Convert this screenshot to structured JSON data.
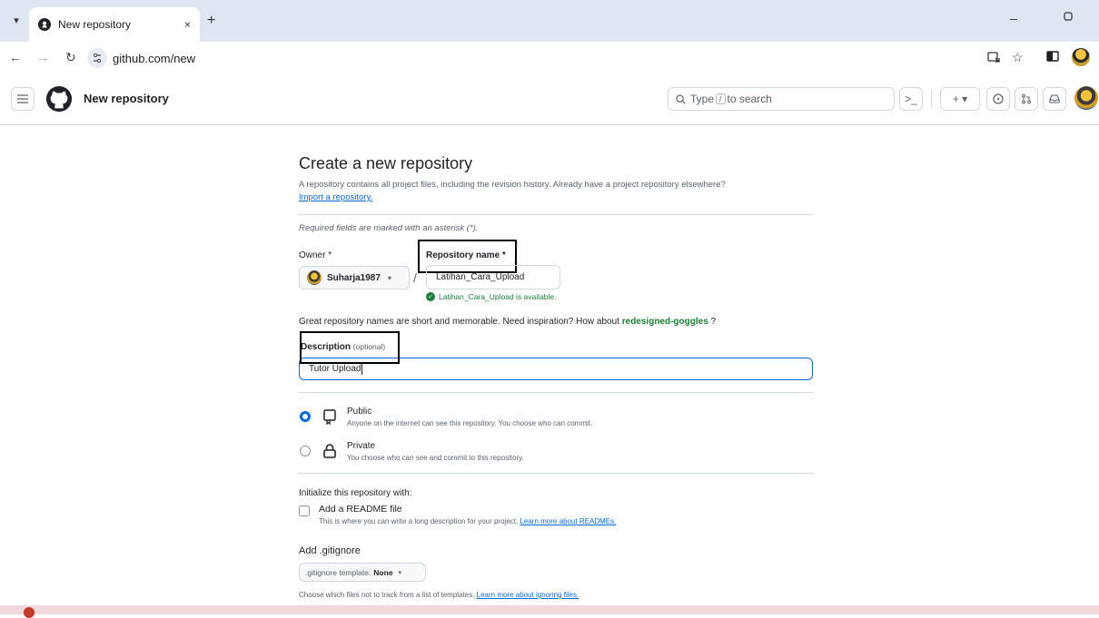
{
  "browser": {
    "tab_title": "New repository",
    "tab_close": "×",
    "new_tab": "+",
    "url": "github.com/new",
    "window_minimize": "–"
  },
  "header": {
    "title": "New repository",
    "search_prefix": "Type",
    "search_key": "/",
    "search_suffix": "to search",
    "terminal_label": ">_",
    "create_label": "+ ▾"
  },
  "page": {
    "heading": "Create a new repository",
    "lead": "A repository contains all project files, including the revision history. Already have a project repository elsewhere?",
    "import_link": "Import a repository.",
    "required_note": "Required fields are marked with an asterisk (*)."
  },
  "form": {
    "owner_label": "Owner *",
    "owner_value": "Suharja1987",
    "repo_name_label": "Repository name *",
    "repo_name_value": "Latihan_Cara_Upload",
    "availability": "Latihan_Cara_Upload is available.",
    "hint_text": "Great repository names are short and memorable. Need inspiration? How about ",
    "hint_suggestion": "redesigned-goggles",
    "hint_end": " ?",
    "description_label": "Description",
    "description_optional": "(optional)",
    "description_value": "Tutor Upload"
  },
  "visibility": {
    "selected": "public",
    "options": [
      {
        "id": "public",
        "title": "Public",
        "desc": "Anyone on the internet can see this repository. You choose who can commit."
      },
      {
        "id": "private",
        "title": "Private",
        "desc": "You choose who can see and commit to this repository."
      }
    ]
  },
  "initialize": {
    "title": "Initialize this repository with:",
    "readme_label": "Add a README file",
    "readme_desc": "This is where you can write a long description for your project.",
    "readme_link": "Learn more about READMEs.",
    "readme_checked": false
  },
  "gitignore": {
    "title": "Add .gitignore",
    "template_prefix": ".gitignore template:",
    "template_value": "None",
    "desc": "Choose which files not to track from a list of templates.",
    "link": "Learn more about ignoring files."
  },
  "colors": {
    "accent": "#0969da",
    "success": "#1a7f37",
    "border": "#d0d7de"
  }
}
